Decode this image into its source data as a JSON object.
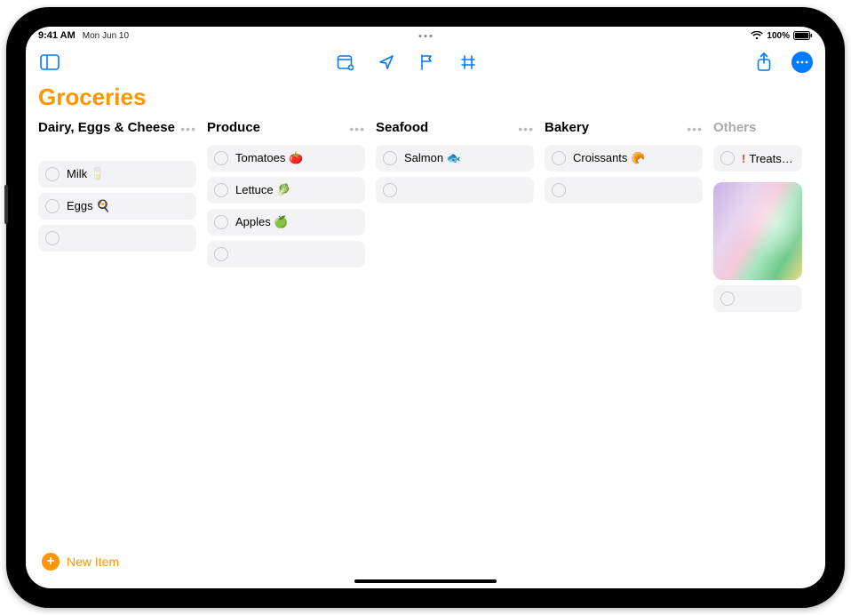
{
  "status": {
    "time": "9:41 AM",
    "date": "Mon Jun 10",
    "battery_pct": "100%"
  },
  "list": {
    "title": "Groceries",
    "new_item_label": "New Item"
  },
  "sections": [
    {
      "title": "Dairy, Eggs & Cheese",
      "items": [
        {
          "label": "Milk 🥛"
        },
        {
          "label": "Eggs 🍳"
        }
      ]
    },
    {
      "title": "Produce",
      "items": [
        {
          "label": "Tomatoes 🍅"
        },
        {
          "label": "Lettuce 🥬"
        },
        {
          "label": "Apples 🍏"
        }
      ]
    },
    {
      "title": "Seafood",
      "items": [
        {
          "label": "Salmon 🐟"
        }
      ]
    },
    {
      "title": "Bakery",
      "items": [
        {
          "label": "Croissants 🥐"
        }
      ]
    },
    {
      "title": "Others",
      "cutoff": true,
      "items": [
        {
          "label": "Treats for",
          "priority": "!"
        }
      ],
      "has_thumbnail": true
    }
  ]
}
